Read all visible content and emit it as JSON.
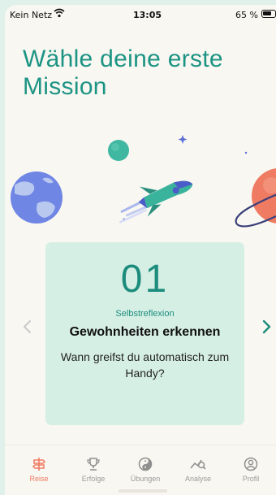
{
  "status_bar": {
    "carrier": "Kein Netz",
    "time": "13:05",
    "battery": "65 %"
  },
  "title": "Wähle deine erste Mission",
  "mission": {
    "number": "01",
    "category": "Selbstreflexion",
    "name": "Gewohnheiten erkennen",
    "question": "Wann greifst du automatisch zum Handy?"
  },
  "tabs": [
    {
      "label": "Reise",
      "icon": "signpost-icon",
      "active": true
    },
    {
      "label": "Erfolge",
      "icon": "trophy-icon",
      "active": false
    },
    {
      "label": "Übungen",
      "icon": "yin-yang-icon",
      "active": false
    },
    {
      "label": "Analyse",
      "icon": "chart-search-icon",
      "active": false
    },
    {
      "label": "Profil",
      "icon": "profile-icon",
      "active": false
    }
  ],
  "colors": {
    "accent": "#1c9484",
    "card": "#d6efe5",
    "active_tab": "#ef7b63"
  }
}
